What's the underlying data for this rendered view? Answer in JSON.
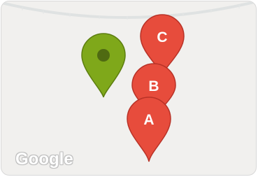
{
  "map": {
    "attribution": "Google",
    "colors": {
      "background": "#f1f0ee",
      "road": "#d9dcdc",
      "marker_red": "#e74c3c",
      "marker_red_stroke": "#b83227",
      "marker_green": "#7fa81a",
      "marker_green_stroke": "#5c7d0f",
      "marker_green_dot": "#4f6a12"
    },
    "markers": [
      {
        "id": "green",
        "icon": "map-pin-icon",
        "color": "green",
        "label": ""
      },
      {
        "id": "C",
        "icon": "map-pin-icon",
        "color": "red",
        "label": "C"
      },
      {
        "id": "B",
        "icon": "map-pin-icon",
        "color": "red",
        "label": "B"
      },
      {
        "id": "A",
        "icon": "map-pin-icon",
        "color": "red",
        "label": "A"
      }
    ]
  }
}
